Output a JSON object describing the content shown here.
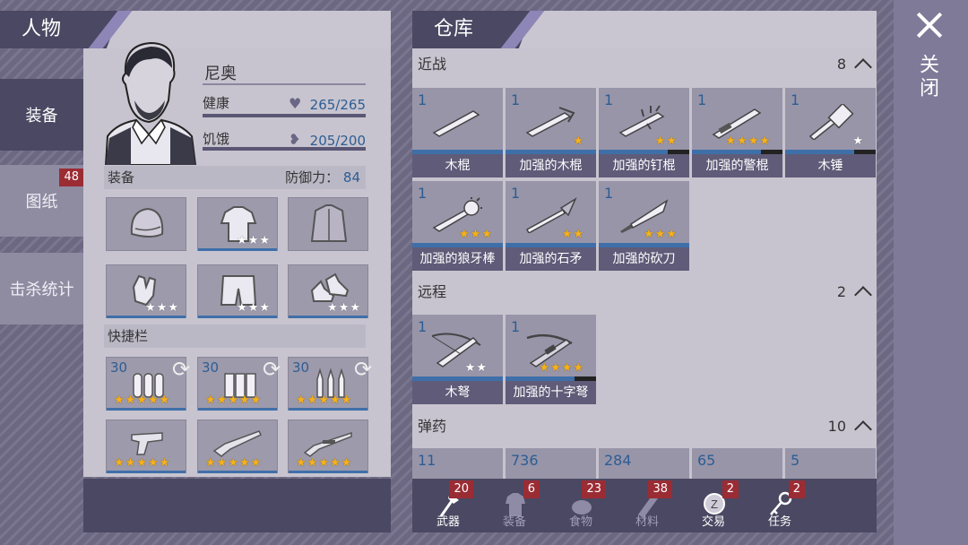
{
  "left_panel": {
    "title": "人物",
    "side_tabs": [
      {
        "label": "装备",
        "active": true
      },
      {
        "label": "图纸",
        "badge": "48"
      },
      {
        "label": "击杀统计"
      }
    ],
    "character": {
      "name": "尼奥",
      "health_label": "健康",
      "health_value": "265/265",
      "hunger_label": "饥饿",
      "hunger_value": "205/200"
    },
    "equipment": {
      "section_label": "装备",
      "defense_label": "防御力：",
      "defense_value": "84",
      "slots": [
        {
          "icon": "helmet-icon",
          "stars": 0
        },
        {
          "icon": "shirt-icon",
          "stars": 3,
          "star_color": "white"
        },
        {
          "icon": "jacket-icon",
          "stars": 0
        },
        {
          "icon": "gloves-icon",
          "stars": 3,
          "star_color": "white"
        },
        {
          "icon": "shorts-icon",
          "stars": 3,
          "star_color": "white"
        },
        {
          "icon": "shoes-icon",
          "stars": 3,
          "star_color": "white"
        }
      ]
    },
    "quickbar": {
      "section_label": "快捷栏",
      "slots": [
        {
          "qty": "30",
          "icon": "bullets-icon",
          "stars": 5
        },
        {
          "qty": "30",
          "icon": "shells-icon",
          "stars": 5
        },
        {
          "qty": "30",
          "icon": "rifle-ammo-icon",
          "stars": 5
        },
        {
          "icon": "revolver-icon",
          "stars": 5
        },
        {
          "icon": "shotgun-icon",
          "stars": 5
        },
        {
          "icon": "rifle-icon",
          "stars": 5
        }
      ]
    }
  },
  "right_panel": {
    "title": "仓库",
    "categories": [
      {
        "label": "近战",
        "count": "8"
      },
      {
        "label": "远程",
        "count": "2"
      },
      {
        "label": "弹药",
        "count": "10"
      }
    ],
    "melee_items": [
      {
        "qty": "1",
        "label": "木棍",
        "stars": 0,
        "icon": "wooden-stick-icon"
      },
      {
        "qty": "1",
        "label": "加强的木棍",
        "stars": 1,
        "icon": "reinforced-stick-icon"
      },
      {
        "qty": "1",
        "label": "加强的钉棍",
        "stars": 2,
        "icon": "spiked-club-icon"
      },
      {
        "qty": "1",
        "label": "加强的警棍",
        "stars": 4,
        "icon": "baton-icon"
      },
      {
        "qty": "1",
        "label": "木锤",
        "stars": 1,
        "star_color": "white",
        "icon": "mallet-icon"
      },
      {
        "qty": "1",
        "label": "加强的狼牙棒",
        "stars": 3,
        "icon": "mace-icon"
      },
      {
        "qty": "1",
        "label": "加强的石矛",
        "stars": 2,
        "icon": "spear-icon"
      },
      {
        "qty": "1",
        "label": "加强的砍刀",
        "stars": 3,
        "icon": "machete-icon"
      }
    ],
    "ranged_items": [
      {
        "qty": "1",
        "label": "木弩",
        "stars": 2,
        "star_color": "white",
        "icon": "wooden-crossbow-icon"
      },
      {
        "qty": "1",
        "label": "加强的十字弩",
        "stars": 4,
        "icon": "crossbow-icon"
      }
    ],
    "ammo_items": [
      {
        "qty": "11"
      },
      {
        "qty": "736"
      },
      {
        "qty": "284"
      },
      {
        "qty": "65"
      },
      {
        "qty": "5"
      }
    ],
    "bottom_tabs": [
      {
        "label": "武器",
        "badge": "20",
        "icon": "axe-icon",
        "active": true
      },
      {
        "label": "装备",
        "badge": "6",
        "icon": "shirt-icon"
      },
      {
        "label": "食物",
        "badge": "23",
        "icon": "food-icon"
      },
      {
        "label": "材料",
        "badge": "38",
        "icon": "materials-icon"
      },
      {
        "label": "交易",
        "badge": "2",
        "icon": "coin-icon",
        "active": true
      },
      {
        "label": "任务",
        "badge": "2",
        "icon": "key-icon",
        "active": true
      }
    ]
  },
  "close": {
    "label": "关闭"
  }
}
